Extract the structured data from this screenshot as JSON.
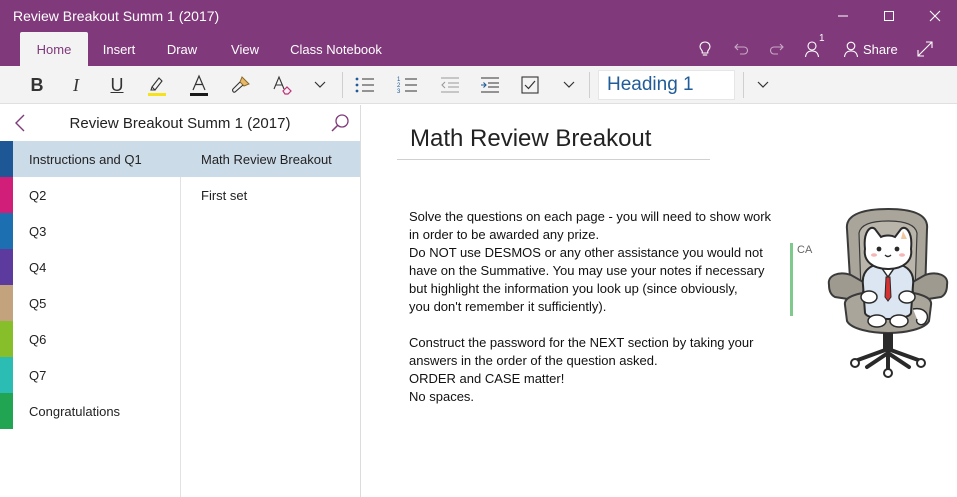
{
  "window": {
    "title": "Review Breakout Summ 1 (2017)"
  },
  "tabs": [
    {
      "label": "Home",
      "active": true
    },
    {
      "label": "Insert"
    },
    {
      "label": "Draw"
    },
    {
      "label": "View"
    },
    {
      "label": "Class Notebook"
    }
  ],
  "toolbar": {
    "share_label": "Share",
    "notification_count": "1"
  },
  "ribbon": {
    "style_value": "Heading 1",
    "highlight_color": "#f5e11c",
    "font_color": "#1a1a1a"
  },
  "nav": {
    "notebook_title": "Review Breakout Summ 1 (2017)",
    "sections": [
      {
        "label": "Instructions and Q1",
        "color": "#1e5796",
        "active": true
      },
      {
        "label": "Q2",
        "color": "#d11f79"
      },
      {
        "label": "Q3",
        "color": "#1c6fb1"
      },
      {
        "label": "Q4",
        "color": "#5d3a9e"
      },
      {
        "label": "Q5",
        "color": "#c2a37d"
      },
      {
        "label": "Q6",
        "color": "#87bf2b"
      },
      {
        "label": "Q7",
        "color": "#2bbdb4"
      },
      {
        "label": "Congratulations",
        "color": "#22a552"
      }
    ],
    "pages": [
      {
        "label": "Math Review Breakout",
        "active": true
      },
      {
        "label": "First set"
      }
    ]
  },
  "page": {
    "title": "Math Review Breakout",
    "author_initials": "CA",
    "lines": [
      "Solve the questions on each page - you will need to show work",
      "in order to be awarded any prize.",
      "Do NOT use DESMOS or any other assistance you would not",
      "have on the Summative.  You may use your notes if necessary",
      "but highlight the information you look up (since obviously,",
      "you don't remember it sufficiently).",
      "",
      "Construct the password for the NEXT section by taking your",
      "answers in the order of the question asked.",
      "ORDER and CASE matter!",
      "No spaces."
    ]
  }
}
